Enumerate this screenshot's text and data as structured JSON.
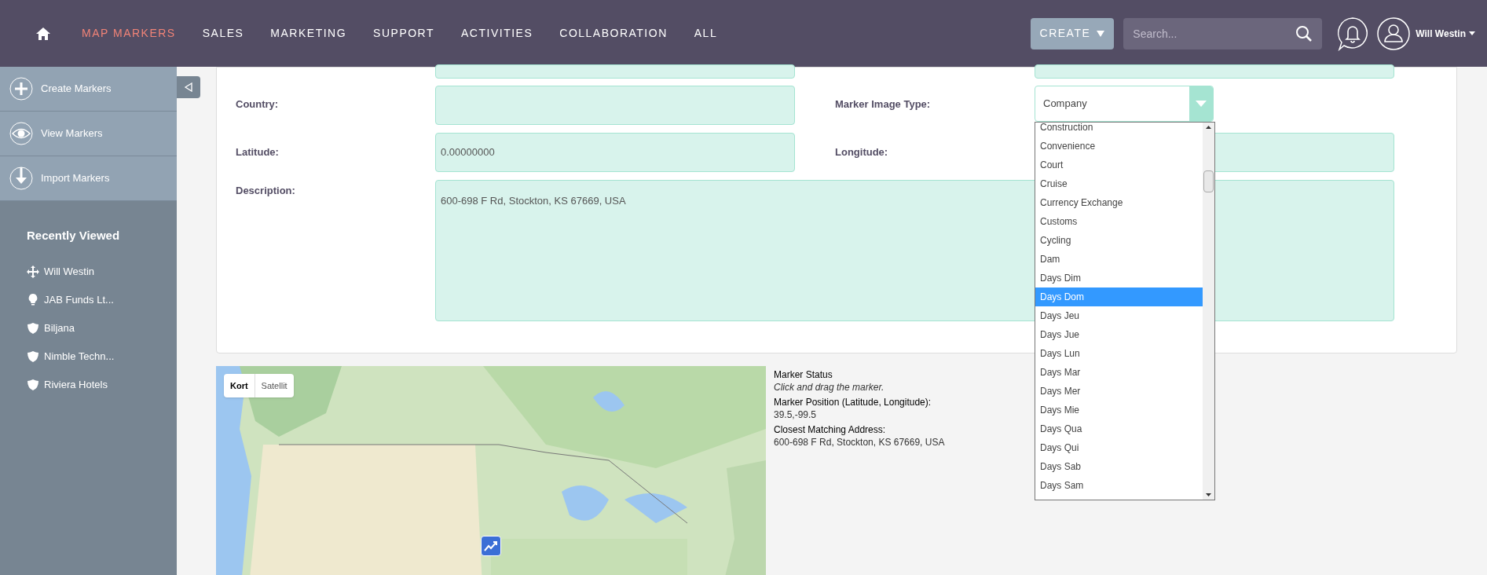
{
  "nav": {
    "items": [
      {
        "label": "MAP MARKERS",
        "selected": true
      },
      {
        "label": "SALES",
        "selected": false
      },
      {
        "label": "MARKETING",
        "selected": false
      },
      {
        "label": "SUPPORT",
        "selected": false
      },
      {
        "label": "ACTIVITIES",
        "selected": false
      },
      {
        "label": "COLLABORATION",
        "selected": false
      },
      {
        "label": "ALL",
        "selected": false
      }
    ],
    "create": "CREATE",
    "search_placeholder": "Search...",
    "user": "Will Westin"
  },
  "sidebar": {
    "actions": [
      {
        "label": "Create Markers",
        "kind": "plus"
      },
      {
        "label": "View Markers",
        "kind": "eye"
      },
      {
        "label": "Import Markers",
        "kind": "down"
      }
    ],
    "recent_title": "Recently Viewed",
    "recent": [
      {
        "label": "Will Westin",
        "kind": "move"
      },
      {
        "label": "JAB Funds Lt...",
        "kind": "bulb"
      },
      {
        "label": "Biljana",
        "kind": "shield"
      },
      {
        "label": "Nimble Techn...",
        "kind": "shield"
      },
      {
        "label": "Riviera Hotels",
        "kind": "shield"
      }
    ]
  },
  "form": {
    "country": {
      "label": "Country:"
    },
    "marker_image_type": {
      "label": "Marker Image Type:",
      "value": "Company"
    },
    "latitude": {
      "label": "Latitude:",
      "value": "0.00000000"
    },
    "longitude": {
      "label": "Longitude:"
    },
    "description": {
      "label": "Description:",
      "value": "600-698 F Rd, Stockton, KS 67669, USA"
    }
  },
  "dropdown": {
    "options": [
      {
        "label": "Construction",
        "selected": false
      },
      {
        "label": "Convenience",
        "selected": false
      },
      {
        "label": "Court",
        "selected": false
      },
      {
        "label": "Cruise",
        "selected": false
      },
      {
        "label": "Currency Exchange",
        "selected": false
      },
      {
        "label": "Customs",
        "selected": false
      },
      {
        "label": "Cycling",
        "selected": false
      },
      {
        "label": "Dam",
        "selected": false
      },
      {
        "label": "Days Dim",
        "selected": false
      },
      {
        "label": "Days Dom",
        "selected": true
      },
      {
        "label": "Days Jeu",
        "selected": false
      },
      {
        "label": "Days Jue",
        "selected": false
      },
      {
        "label": "Days Lun",
        "selected": false
      },
      {
        "label": "Days Mar",
        "selected": false
      },
      {
        "label": "Days Mer",
        "selected": false
      },
      {
        "label": "Days Mie",
        "selected": false
      },
      {
        "label": "Days Qua",
        "selected": false
      },
      {
        "label": "Days Qui",
        "selected": false
      },
      {
        "label": "Days Sab",
        "selected": false
      },
      {
        "label": "Days Sam",
        "selected": false
      }
    ]
  },
  "map": {
    "types": [
      {
        "label": "Kort",
        "selected": true
      },
      {
        "label": "Satellit",
        "selected": false
      }
    ]
  },
  "marker_info": [
    {
      "text": "Marker Status",
      "kind": "heading"
    },
    {
      "text": "Click and drag the marker.",
      "kind": "hint"
    },
    {
      "text": "Marker Position (Latitude, Longitude):",
      "kind": "heading"
    },
    {
      "text": "39.5,-99.5",
      "kind": "value"
    },
    {
      "text": "Closest Matching Address:",
      "kind": "heading"
    },
    {
      "text": "600-698 F Rd, Stockton, KS 67669, USA",
      "kind": "value"
    }
  ]
}
